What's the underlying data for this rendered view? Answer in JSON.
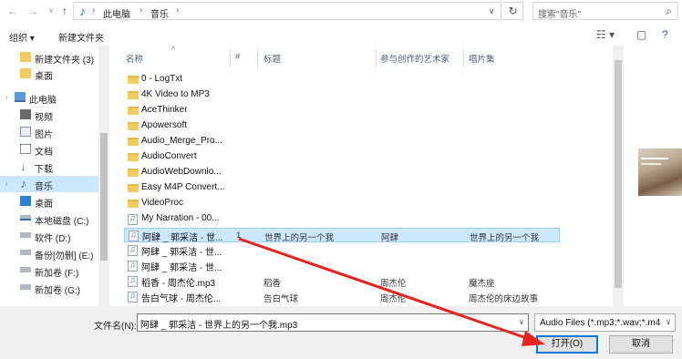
{
  "address": {
    "crumbs": [
      "此电脑",
      "音乐"
    ],
    "search_placeholder": "搜索\"音乐\""
  },
  "toolbar": {
    "organize": "组织 ▾",
    "new_folder": "新建文件夹"
  },
  "nav": {
    "items": [
      {
        "label": "新建文件夹 (3)",
        "icon": "folder-icon"
      },
      {
        "label": "桌面",
        "icon": "folder-icon"
      },
      {
        "label": "此电脑",
        "icon": "computer-icon"
      },
      {
        "label": "视频",
        "icon": "video-icon"
      },
      {
        "label": "图片",
        "icon": "image-icon"
      },
      {
        "label": "文档",
        "icon": "document-icon"
      },
      {
        "label": "下载",
        "icon": "download-icon"
      },
      {
        "label": "音乐",
        "icon": "music-icon"
      },
      {
        "label": "桌面",
        "icon": "desktop-icon"
      },
      {
        "label": "本地磁盘 (C:)",
        "icon": "drive-icon"
      },
      {
        "label": "软件 (D:)",
        "icon": "drive-icon"
      },
      {
        "label": "备份[勿删] (E:)",
        "icon": "drive-icon"
      },
      {
        "label": "新加卷 (F:)",
        "icon": "drive-icon"
      },
      {
        "label": "新加卷 (G:)",
        "icon": "drive-icon"
      }
    ]
  },
  "columns": {
    "name": "名称",
    "number": "#",
    "title": "标题",
    "artist": "参与创作的艺术家",
    "album": "唱片集"
  },
  "files": [
    {
      "name": "0 - LogTxt",
      "type": "folder",
      "num": "",
      "title": "",
      "artist": "",
      "album": ""
    },
    {
      "name": "4K Video to MP3",
      "type": "folder",
      "num": "",
      "title": "",
      "artist": "",
      "album": ""
    },
    {
      "name": "AceThinker",
      "type": "folder",
      "num": "",
      "title": "",
      "artist": "",
      "album": ""
    },
    {
      "name": "Apowersoft",
      "type": "folder",
      "num": "",
      "title": "",
      "artist": "",
      "album": ""
    },
    {
      "name": "Audio_Merge_Pro...",
      "type": "folder",
      "num": "",
      "title": "",
      "artist": "",
      "album": ""
    },
    {
      "name": "AudioConvert",
      "type": "folder",
      "num": "",
      "title": "",
      "artist": "",
      "album": ""
    },
    {
      "name": "AudioWebDownlo...",
      "type": "folder",
      "num": "",
      "title": "",
      "artist": "",
      "album": ""
    },
    {
      "name": "Easy M4P Convert...",
      "type": "folder",
      "num": "",
      "title": "",
      "artist": "",
      "album": ""
    },
    {
      "name": "VideoProc",
      "type": "folder",
      "num": "",
      "title": "",
      "artist": "",
      "album": ""
    },
    {
      "name": "My Narration - 00...",
      "type": "audio",
      "num": "",
      "title": "",
      "artist": "",
      "album": ""
    },
    {
      "name": "阿肆 _ 郭采洁 - 世...",
      "type": "audio",
      "num": "1",
      "title": "世界上的另一个我",
      "artist": "阿肆",
      "album": "世界上的另一个我",
      "selected": true
    },
    {
      "name": "阿肆 _ 郭采洁 - 世...",
      "type": "audio",
      "num": "",
      "title": "",
      "artist": "",
      "album": ""
    },
    {
      "name": "阿肆 _ 郭采洁 - 世...",
      "type": "audio",
      "num": "",
      "title": "",
      "artist": "",
      "album": ""
    },
    {
      "name": "稻香 - 周杰伦.mp3",
      "type": "audio",
      "num": "",
      "title": "稻香",
      "artist": "周杰伦",
      "album": "魔杰座"
    },
    {
      "name": "告白气球 - 周杰伦...",
      "type": "audio",
      "num": "",
      "title": "告白气球",
      "artist": "周杰伦",
      "album": "周杰伦的床边故事"
    }
  ],
  "footer": {
    "filename_label": "文件名(N):",
    "filename_value": "阿肆 _ 郭采洁 - 世界上的另一个我.mp3",
    "filetype_value": "Audio Files (*.mp3;*.wav;*.m4",
    "open_label": "打开(O)",
    "cancel_label": "取消"
  },
  "colors": {
    "selection": "#cce8ff",
    "accent": "#0078d7",
    "annotation": "#e8231f"
  }
}
